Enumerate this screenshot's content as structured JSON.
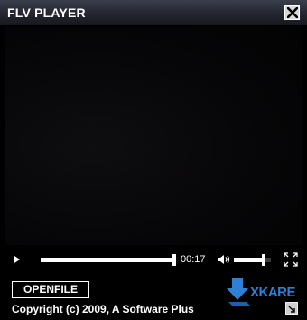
{
  "window": {
    "title": "FLV PLAYER"
  },
  "player": {
    "time": "00:17",
    "progress_fraction": 1.0,
    "volume_fraction": 0.78
  },
  "footer": {
    "open_file_label": "OPENFILE",
    "copyright": "Copyright (c) 2009, A Software Plus",
    "logo_text": "XKARE"
  },
  "colors": {
    "background": "#000000",
    "titlebar": "#2a2d37",
    "accent": "#2f7fd6",
    "text": "#ffffff"
  },
  "icons": {
    "close": "close-icon",
    "play": "play-icon",
    "volume": "volume-icon",
    "fullscreen": "fullscreen-icon",
    "resize": "resize-grip-icon"
  }
}
